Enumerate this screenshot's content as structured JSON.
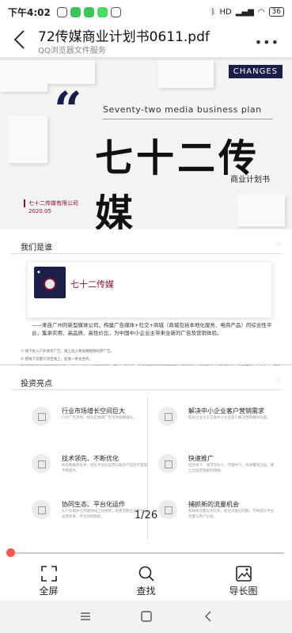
{
  "status": {
    "time": "下午4:02",
    "signal": "HD",
    "battery": "36"
  },
  "header": {
    "title": "72传媒商业计划书0611.pdf",
    "subtitle": "QQ浏览器文件服务"
  },
  "cover": {
    "logo": "CHANGES",
    "en_title": "Seventy-two media business plan",
    "title": "七十二传媒",
    "subtitle": "商业计划书",
    "company": "七十二传媒有限公司",
    "date": "2020.05"
  },
  "about": {
    "heading": "我们是谁",
    "brand": "七十二传媒",
    "desc": "——来自广州的新型媒体公司，构建广告媒体+社交+商城（商城包括本地化服务、电商产品）的综合性平台，集承实用、高品质、高性价比，为中国中小企业主带来全新的广告及营销体验。",
    "bullets": [
      "① 线下投入户外商务广告，线上投入移动端视频同步广告。",
      "② 把线下流量引流至线上，促进一条龙合作。",
      "在线下商场的楼宇和商圈投放，通过大小屏（线下电梯屏、平台）的联动，构建完整的宣传矩阵和平台的自服务，资源整合、全渠道收益，全面覆盖中小企业主，实施上通过线端数据及其商业数据规划，提前引导和搭建布局商城建设，在投放广告的过程中，为其在广告业主品牌营销。"
    ]
  },
  "highlights": {
    "heading": "投资亮点",
    "items": [
      {
        "title": "行业市场增长空间巨大",
        "desc": "户外广告市场、移动互联网广告市场规模增长。"
      },
      {
        "title": "解决中小企业客户营销需求",
        "desc": "帮助企业主于互联中小企业客户解决营销难的问题。"
      },
      {
        "title": "技术领先、不断优化",
        "desc": "依靠数据和技术，优化平台的运营与服务产品迭代速度不断提升。"
      },
      {
        "title": "快速推广",
        "desc": "结合线下、城市合伙人、代理中介，快速覆盖全国，建立全国营销服务网络。"
      },
      {
        "title": "协同生态、平台化运作",
        "desc": "从户外媒体化传播到线上短视频，搭建完整生态平台化运营体系，平台持续赋能。"
      },
      {
        "title": "捕抓新的流量机会",
        "desc": "新媒体流量分享红利，抓住流量红利期，不断提升平台流量与用户价值。"
      }
    ]
  },
  "viewer": {
    "page_indicator": "1/26",
    "progress_fraction": 0.0
  },
  "toolbar": {
    "fullscreen": "全屏",
    "search": "查找",
    "export_image": "导长图"
  }
}
